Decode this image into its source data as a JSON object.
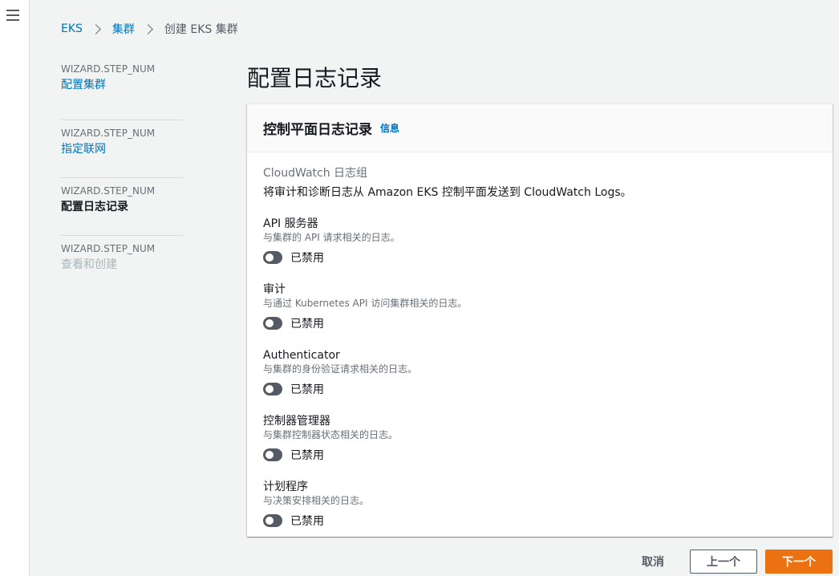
{
  "breadcrumb": {
    "root": "EKS",
    "clusters": "集群",
    "current": "创建 EKS 集群"
  },
  "steps": [
    {
      "num": "WIZARD.STEP_NUM",
      "title": "配置集群",
      "state": "link"
    },
    {
      "num": "WIZARD.STEP_NUM",
      "title": "指定联网",
      "state": "link"
    },
    {
      "num": "WIZARD.STEP_NUM",
      "title": "配置日志记录",
      "state": "active"
    },
    {
      "num": "WIZARD.STEP_NUM",
      "title": "查看和创建",
      "state": "disabled"
    }
  ],
  "page": {
    "title": "配置日志记录"
  },
  "panel": {
    "title": "控制平面日志记录",
    "info": "信息",
    "group_label": "CloudWatch 日志组",
    "group_desc": "将审计和诊断日志从 Amazon EKS 控制平面发送到 CloudWatch Logs。"
  },
  "logs": [
    {
      "title": "API 服务器",
      "desc": "与集群的 API 请求相关的日志。",
      "status": "已禁用"
    },
    {
      "title": "审计",
      "desc": "与通过 Kubernetes API 访问集群相关的日志。",
      "status": "已禁用"
    },
    {
      "title": "Authenticator",
      "desc": "与集群的身份验证请求相关的日志。",
      "status": "已禁用"
    },
    {
      "title": "控制器管理器",
      "desc": "与集群控制器状态相关的日志。",
      "status": "已禁用"
    },
    {
      "title": "计划程序",
      "desc": "与决策安排相关的日志。",
      "status": "已禁用"
    }
  ],
  "footer": {
    "cancel": "取消",
    "previous": "上一个",
    "next": "下一个"
  },
  "colors": {
    "accent": "#0073bb",
    "primary": "#ec7211",
    "toggle_off": "#545b64"
  }
}
